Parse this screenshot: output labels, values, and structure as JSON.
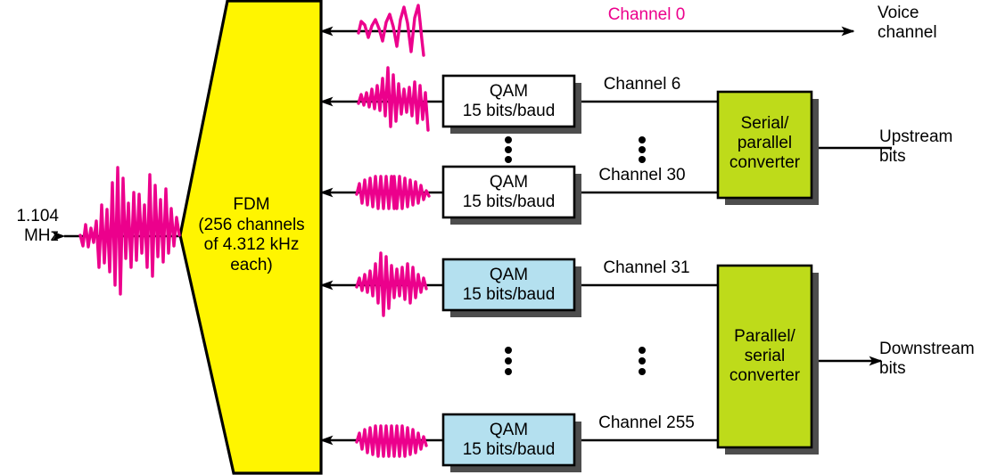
{
  "diagram": {
    "title": "ADSL FDM modulation block diagram",
    "colors": {
      "fdm_fill": "#FFF500",
      "converter_fill": "#BEDB1A",
      "qam_upstream_fill": "#FFFFFF",
      "qam_downstream_fill": "#B4E0EF",
      "signal_wave": "#EC008C",
      "line": "#000000",
      "shadow": "#4D4D4D"
    },
    "output_label": "1.104\nMHz",
    "fdm_block": {
      "name": "FDM",
      "text": "FDM\n(256 channels\nof 4.312 kHz\neach)"
    },
    "channel_labels": {
      "voice": "Channel 0",
      "upstream_first": "Channel 6",
      "upstream_last": "Channel 30",
      "downstream_first": "Channel 31",
      "downstream_last": "Channel 255"
    },
    "endpoint_labels": {
      "voice": "Voice\nchannel",
      "upstream": "Upstream\nbits",
      "downstream": "Downstream\nbits"
    },
    "qam_boxes": [
      {
        "id": "qam-upstream-1",
        "line1": "QAM",
        "line2": "15 bits/baud",
        "variant": "upstream"
      },
      {
        "id": "qam-upstream-2",
        "line1": "QAM",
        "line2": "15 bits/baud",
        "variant": "upstream"
      },
      {
        "id": "qam-downstream-1",
        "line1": "QAM",
        "line2": "15 bits/baud",
        "variant": "downstream"
      },
      {
        "id": "qam-downstream-2",
        "line1": "QAM",
        "line2": "15 bits/baud",
        "variant": "downstream"
      }
    ],
    "converters": [
      {
        "id": "serial-parallel",
        "text": "Serial/\nparallel\nconverter"
      },
      {
        "id": "parallel-serial",
        "text": "Parallel/\nserial\nconverter"
      }
    ],
    "ellipses": [
      {
        "id": "ellipsis-qam-upstream"
      },
      {
        "id": "ellipsis-channel-upstream"
      },
      {
        "id": "ellipsis-qam-downstream"
      },
      {
        "id": "ellipsis-channel-downstream"
      }
    ],
    "icons": {
      "waveform": "waveform-icon",
      "arrow_left": "arrow-left-icon",
      "arrow_right": "arrow-right-icon",
      "vertical_ellipsis": "vertical-ellipsis-icon"
    }
  }
}
